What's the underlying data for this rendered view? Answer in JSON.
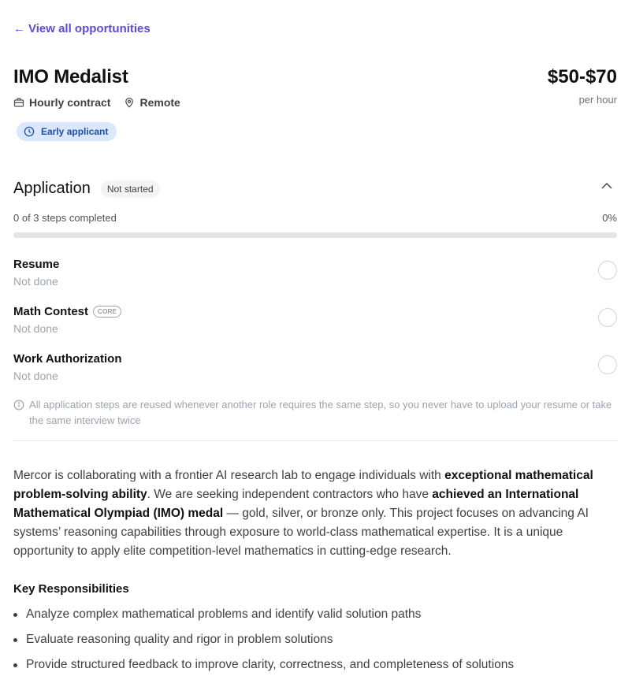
{
  "nav": {
    "back_arrow": "←",
    "back_label": "View all opportunities"
  },
  "job": {
    "title": "IMO Medalist",
    "contract_type": "Hourly contract",
    "location": "Remote",
    "rate": "$50-$70",
    "rate_unit": "per hour",
    "badge": "Early applicant"
  },
  "application": {
    "title": "Application",
    "status": "Not started",
    "progress_label": "0 of 3 steps completed",
    "progress_percent_label": "0%",
    "progress_fraction": 0,
    "steps": [
      {
        "name": "Resume",
        "status": "Not done",
        "tag": ""
      },
      {
        "name": "Math Contest",
        "status": "Not done",
        "tag": "CORE"
      },
      {
        "name": "Work Authorization",
        "status": "Not done",
        "tag": ""
      }
    ],
    "note": "All application steps are reused whenever another role requires the same step, so you never have to upload your resume or take the same interview twice"
  },
  "description": {
    "p1_a": "Mercor is collaborating with a frontier AI research lab to engage individuals with ",
    "p1_b": "exceptional mathematical problem-solving ability",
    "p1_c": ". We are seeking independent contractors who have ",
    "p1_d": "achieved an International Mathematical Olympiad (IMO) medal",
    "p1_e": " — gold, silver, or bronze only. This project focuses on advancing AI systems’ reasoning capabilities through exposure to world-class mathematical expertise. It is a unique opportunity to apply elite competition-level mathematics in cutting-edge research."
  },
  "responsibilities": {
    "title": "Key Responsibilities",
    "items": [
      "Analyze complex mathematical problems and identify valid solution paths",
      "Evaluate reasoning quality and rigor in problem solutions",
      "Provide structured feedback to improve clarity, correctness, and completeness of solutions"
    ]
  },
  "icons": {
    "contract": "briefcase-icon",
    "location": "map-pin-icon",
    "badge": "clock-icon",
    "collapse": "chevron-up-icon",
    "note": "info-icon"
  },
  "colors": {
    "accent": "#5b4bdb",
    "badge_bg": "#dbe8fb",
    "badge_text": "#1e4fae"
  }
}
